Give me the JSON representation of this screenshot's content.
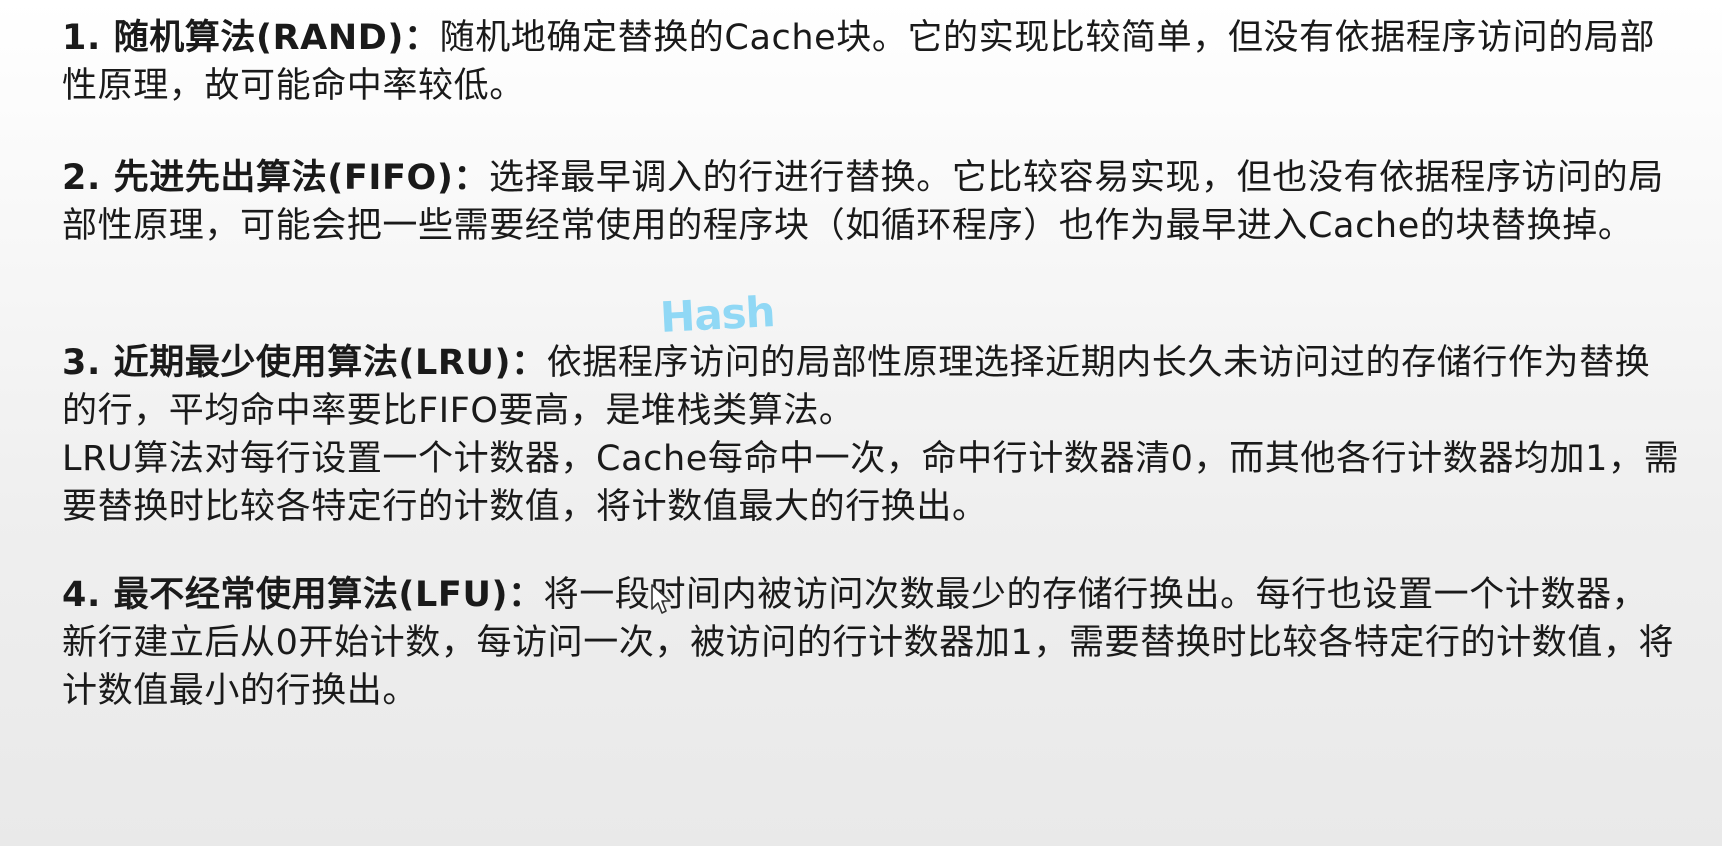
{
  "items": [
    {
      "lead": "1. 随机算法(RAND)：",
      "text": "随机地确定替换的Cache块。它的实现比较简单，但没有依据程序访问的局部性原理，故可能命中率较低。"
    },
    {
      "lead": "2. 先进先出算法(FIFO)：",
      "text": "选择最早调入的行进行替换。它比较容易实现，但也没有依据程序访问的局部性原理，可能会把一些需要经常使用的程序块（如循环程序）也作为最早进入Cache的块替换掉。"
    },
    {
      "lead": "3. 近期最少使用算法(LRU)：",
      "text": "依据程序访问的局部性原理选择近期内长久未访问过的存储行作为替换的行，平均命中率要比FIFO要高，是堆栈类算法。",
      "extra": "LRU算法对每行设置一个计数器，Cache每命中一次，命中行计数器清0，而其他各行计数器均加1，需要替换时比较各特定行的计数值，将计数值最大的行换出。"
    },
    {
      "lead": "4. 最不经常使用算法(LFU)：",
      "text": "将一段时间内被访问次数最少的存储行换出。每行也设置一个计数器，新行建立后从0开始计数，每访问一次，被访问的行计数器加1，需要替换时比较各特定行的计数值，将计数值最小的行换出。"
    }
  ],
  "watermark": "Hash",
  "icons": {
    "cursor": "mouse-pointer-icon"
  },
  "colors": {
    "text": "#1a1a1a",
    "watermark": "#7fd3f5"
  }
}
